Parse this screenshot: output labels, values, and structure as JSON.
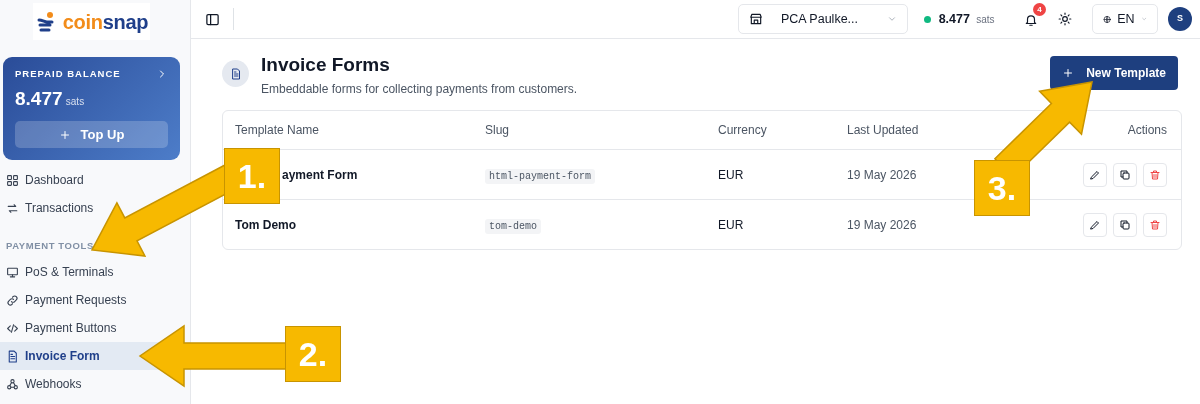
{
  "sidebar": {
    "logo": {
      "parts": [
        "coin",
        "snap"
      ]
    },
    "balance": {
      "label": "PREPAID BALANCE",
      "amount": "8.477",
      "unit": "sats",
      "button": "Top Up"
    },
    "nav": [
      {
        "kind": "item",
        "label": "Dashboard",
        "selected": false
      },
      {
        "kind": "item",
        "label": "Transactions",
        "selected": false
      },
      {
        "kind": "section",
        "label": "PAYMENT TOOLS"
      },
      {
        "kind": "item",
        "label": "PoS & Terminals",
        "selected": false
      },
      {
        "kind": "item",
        "label": "Payment Requests",
        "selected": false
      },
      {
        "kind": "item",
        "label": "Payment Buttons",
        "selected": false
      },
      {
        "kind": "item",
        "label": "Invoice Form",
        "selected": true
      },
      {
        "kind": "item",
        "label": "Webhooks",
        "selected": false
      }
    ]
  },
  "topbar": {
    "store": "PCA Paulke...",
    "balance": "8.477",
    "unit": "sats",
    "notifications": "4",
    "language": "EN",
    "avatar": "S"
  },
  "page": {
    "title": "Invoice Forms",
    "subtitle": "Embeddable forms for collecting payments from customers.",
    "button": "New Template"
  },
  "table": {
    "columns": [
      "Template Name",
      "Slug",
      "Currency",
      "Last Updated",
      "Actions"
    ],
    "rows": [
      {
        "name": "ayment Form",
        "slug": "html-payment-form",
        "currency": "EUR",
        "updated": "19 May 2026"
      },
      {
        "name": "Tom Demo",
        "slug": "tom-demo",
        "currency": "EUR",
        "updated": "19 May 2026"
      }
    ]
  },
  "callouts": [
    {
      "label": "1."
    },
    {
      "label": "2."
    },
    {
      "label": "3."
    }
  ]
}
